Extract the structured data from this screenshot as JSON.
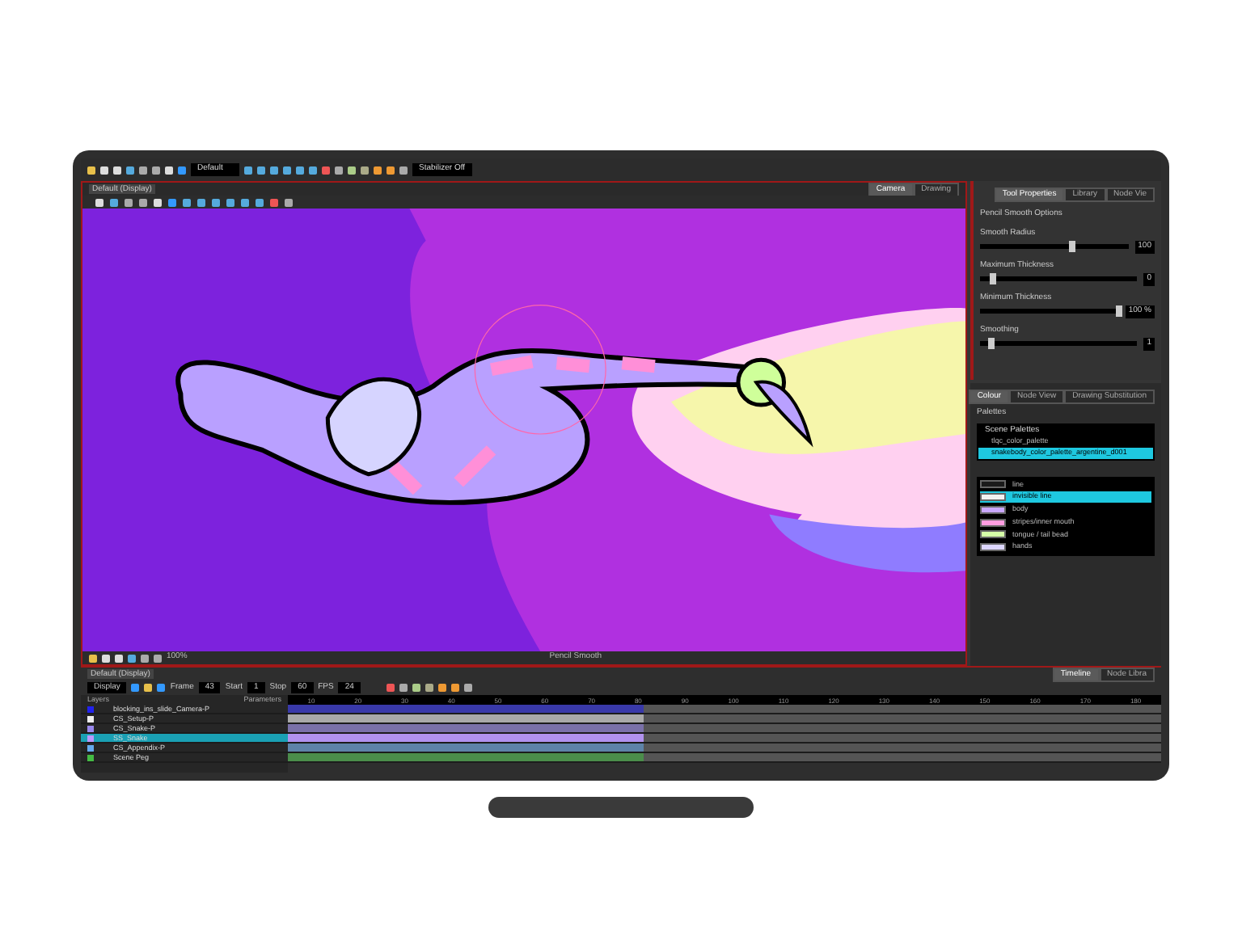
{
  "toolbar": {
    "workspace": "Default",
    "stabilizer": "Stabilizer Off"
  },
  "viewport": {
    "tab": "Default (Display)",
    "view_tabs": [
      {
        "label": "Camera",
        "selected": true
      },
      {
        "label": "Drawing",
        "selected": false
      }
    ],
    "zoom": "100%",
    "status_tool": "Pencil Smooth"
  },
  "tool_panel": {
    "tabs": [
      {
        "label": "Tool Properties",
        "selected": true
      },
      {
        "label": "Library",
        "selected": false
      },
      {
        "label": "Node Vie",
        "selected": false
      }
    ],
    "heading": "Pencil Smooth Options",
    "sliders": [
      {
        "label": "Smooth Radius",
        "level": 0.62,
        "reading": "100"
      },
      {
        "label": "Maximum Thickness",
        "level": 0.08,
        "reading": "0"
      },
      {
        "label": "Minimum Thickness",
        "level": 1.0,
        "reading": "100 %"
      },
      {
        "label": "Smoothing",
        "level": 0.07,
        "reading": "1"
      }
    ]
  },
  "colour_panel": {
    "tabs": [
      {
        "label": "Colour",
        "selected": true
      },
      {
        "label": "Node View",
        "selected": false
      },
      {
        "label": "Drawing Substitution",
        "selected": false
      }
    ],
    "palettes_title": "Palettes",
    "scene_palettes": "Scene Palettes",
    "palettes": [
      {
        "name": "tlqc_color_palette",
        "selected": false
      },
      {
        "name": "snakebody_color_palette_argentine_d001",
        "selected": true
      }
    ],
    "swatches": [
      {
        "name": "line",
        "color": "#1a1a1a",
        "selected": false
      },
      {
        "name": "invisible line",
        "color": "#f2f2f2",
        "selected": true
      },
      {
        "name": "body",
        "color": "#c9a7ff",
        "selected": false
      },
      {
        "name": "stripes/inner mouth",
        "color": "#ff9de0",
        "selected": false
      },
      {
        "name": "tongue / tail bead",
        "color": "#d6ffa8",
        "selected": false
      },
      {
        "name": "hands",
        "color": "#dcd6ff",
        "selected": false
      }
    ]
  },
  "timeline": {
    "tab": "Default (Display)",
    "display": "Display",
    "frame_label": "Frame",
    "frame": "43",
    "start_label": "Start",
    "start": "1",
    "stop_label": "Stop",
    "stop": "60",
    "fps_label": "FPS",
    "fps": "24",
    "layers_header": "Layers",
    "params_header": "Parameters",
    "side_tabs": [
      {
        "label": "Timeline",
        "selected": true
      },
      {
        "label": "Node Libra",
        "selected": false
      }
    ],
    "layers": [
      {
        "name": "blocking_ins_slide_Camera-P",
        "color": "#2222ee",
        "selected": false
      },
      {
        "name": "CS_Setup-P",
        "color": "#eeeeee",
        "selected": false
      },
      {
        "name": "CS_Snake-P",
        "color": "#9988ee",
        "selected": false
      },
      {
        "name": "SS_Snake",
        "color": "#bb99ff",
        "selected": true
      },
      {
        "name": "CS_Appendix-P",
        "color": "#66aaee",
        "selected": false
      },
      {
        "name": "Scene Peg",
        "color": "#44bb44",
        "selected": false
      }
    ],
    "ruler": [
      "10",
      "20",
      "30",
      "40",
      "50",
      "60",
      "70",
      "80",
      "90",
      "100",
      "110",
      "120",
      "130",
      "140",
      "150",
      "160",
      "170",
      "180"
    ]
  }
}
